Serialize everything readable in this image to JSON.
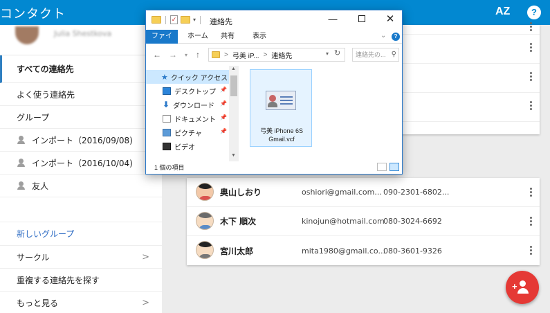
{
  "app": {
    "title": "コンタクト",
    "sort_icon_label": "AZ",
    "help_icon_label": "?"
  },
  "profile": {
    "name": "Julia Shestkova"
  },
  "sidebar": {
    "items": [
      {
        "label": "すべての連絡先"
      },
      {
        "label": "よく使う連絡先"
      },
      {
        "label": "グループ"
      },
      {
        "label": "インポート（2016/09/08)"
      },
      {
        "label": "インポート（2016/10/04)"
      },
      {
        "label": "友人"
      },
      {
        "label": "新しいグループ"
      },
      {
        "label": "サークル",
        "chevron": ">"
      },
      {
        "label": "重複する連絡先を探す"
      },
      {
        "label": "もっと見る",
        "chevron": ">"
      }
    ]
  },
  "contacts": [
    {
      "name": "奥山しおり",
      "email": "oshiori@gmail.com...",
      "phone": "090-2301-6802..."
    },
    {
      "name": "木下 順次",
      "email": "kinojun@hotmail.com",
      "phone": "080-3024-6692"
    },
    {
      "name": "宮川太郎",
      "email": "mita1980@gmail.co...",
      "phone": "080-3601-9326"
    }
  ],
  "explorer": {
    "title": "連絡先",
    "ribbon": {
      "file": "ファイル",
      "home": "ホーム",
      "share": "共有",
      "view": "表示"
    },
    "address": {
      "crumb1": "弓美 iP...",
      "sep": ">",
      "crumb2": "連絡先"
    },
    "search_placeholder": "連絡先の...",
    "nav": [
      {
        "label": "クイック アクセス"
      },
      {
        "label": "デスクトップ"
      },
      {
        "label": "ダウンロード"
      },
      {
        "label": "ドキュメント"
      },
      {
        "label": "ピクチャ"
      },
      {
        "label": "ビデオ"
      }
    ],
    "file": {
      "name": "弓美 iPhone 6S Gmail.vcf"
    },
    "status": "1 個の項目"
  },
  "colors": {
    "header": "#0288d1",
    "fab": "#e53935",
    "explorer_accent": "#1979ca"
  }
}
